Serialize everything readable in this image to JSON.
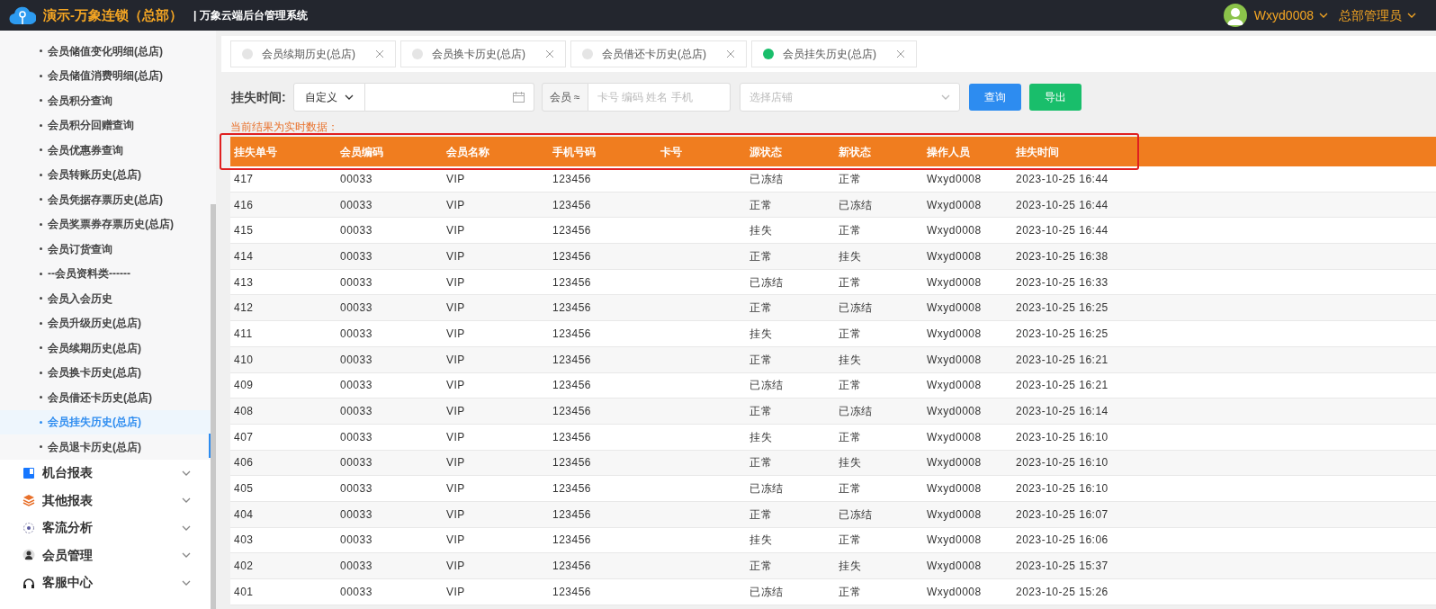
{
  "header": {
    "brand": "演示-万象连锁（总部）",
    "system": "| 万象云端后台管理系统",
    "user": "Wxyd0008",
    "role": "总部管理员"
  },
  "sidebar": {
    "items": [
      {
        "label": "会员储值变化明细(总店)",
        "selected": false
      },
      {
        "label": "会员储值消费明细(总店)",
        "selected": false
      },
      {
        "label": "会员积分查询",
        "selected": false
      },
      {
        "label": "会员积分回赠查询",
        "selected": false
      },
      {
        "label": "会员优惠券查询",
        "selected": false
      },
      {
        "label": "会员转账历史(总店)",
        "selected": false
      },
      {
        "label": "会员凭据存票历史(总店)",
        "selected": false
      },
      {
        "label": "会员奖票券存票历史(总店)",
        "selected": false
      },
      {
        "label": "会员订货查询",
        "selected": false
      },
      {
        "label": "--会员资料类------",
        "selected": false
      },
      {
        "label": "会员入会历史",
        "selected": false
      },
      {
        "label": "会员升级历史(总店)",
        "selected": false
      },
      {
        "label": "会员续期历史(总店)",
        "selected": false
      },
      {
        "label": "会员换卡历史(总店)",
        "selected": false
      },
      {
        "label": "会员借还卡历史(总店)",
        "selected": false
      },
      {
        "label": "会员挂失历史(总店)",
        "selected": true
      },
      {
        "label": "会员退卡历史(总店)",
        "selected": false
      }
    ],
    "groups": [
      {
        "label": "机台报表",
        "expanded": false
      },
      {
        "label": "其他报表",
        "expanded": false
      },
      {
        "label": "客流分析",
        "expanded": false
      },
      {
        "label": "会员管理",
        "expanded": false
      },
      {
        "label": "客服中心",
        "expanded": false
      }
    ]
  },
  "tabs": [
    {
      "label": "会员续期历史(总店)",
      "selected": false
    },
    {
      "label": "会员换卡历史(总店)",
      "selected": false
    },
    {
      "label": "会员借还卡历史(总店)",
      "selected": false
    },
    {
      "label": "会员挂失历史(总店)",
      "selected": true
    }
  ],
  "filters": {
    "time_label": "挂失时间:",
    "range": "自定义",
    "member_prefix": "会员 ≈",
    "member_placeholder": "卡号 编码 姓名 手机",
    "store_placeholder": "选择店铺",
    "query": "查询",
    "export": "导出"
  },
  "notice": "当前结果为实时数据：",
  "table": {
    "columns": [
      "挂失单号",
      "会员编码",
      "会员名称",
      "手机号码",
      "卡号",
      "源状态",
      "新状态",
      "操作人员",
      "挂失时间"
    ],
    "rows": [
      [
        "417",
        "00033",
        "VIP",
        "123456",
        "",
        "已冻结",
        "正常",
        "Wxyd0008",
        "2023-10-25 16:44"
      ],
      [
        "416",
        "00033",
        "VIP",
        "123456",
        "",
        "正常",
        "已冻结",
        "Wxyd0008",
        "2023-10-25 16:44"
      ],
      [
        "415",
        "00033",
        "VIP",
        "123456",
        "",
        "挂失",
        "正常",
        "Wxyd0008",
        "2023-10-25 16:44"
      ],
      [
        "414",
        "00033",
        "VIP",
        "123456",
        "",
        "正常",
        "挂失",
        "Wxyd0008",
        "2023-10-25 16:38"
      ],
      [
        "413",
        "00033",
        "VIP",
        "123456",
        "",
        "已冻结",
        "正常",
        "Wxyd0008",
        "2023-10-25 16:33"
      ],
      [
        "412",
        "00033",
        "VIP",
        "123456",
        "",
        "正常",
        "已冻结",
        "Wxyd0008",
        "2023-10-25 16:25"
      ],
      [
        "411",
        "00033",
        "VIP",
        "123456",
        "",
        "挂失",
        "正常",
        "Wxyd0008",
        "2023-10-25 16:25"
      ],
      [
        "410",
        "00033",
        "VIP",
        "123456",
        "",
        "正常",
        "挂失",
        "Wxyd0008",
        "2023-10-25 16:21"
      ],
      [
        "409",
        "00033",
        "VIP",
        "123456",
        "",
        "已冻结",
        "正常",
        "Wxyd0008",
        "2023-10-25 16:21"
      ],
      [
        "408",
        "00033",
        "VIP",
        "123456",
        "",
        "正常",
        "已冻结",
        "Wxyd0008",
        "2023-10-25 16:14"
      ],
      [
        "407",
        "00033",
        "VIP",
        "123456",
        "",
        "挂失",
        "正常",
        "Wxyd0008",
        "2023-10-25 16:10"
      ],
      [
        "406",
        "00033",
        "VIP",
        "123456",
        "",
        "正常",
        "挂失",
        "Wxyd0008",
        "2023-10-25 16:10"
      ],
      [
        "405",
        "00033",
        "VIP",
        "123456",
        "",
        "已冻结",
        "正常",
        "Wxyd0008",
        "2023-10-25 16:10"
      ],
      [
        "404",
        "00033",
        "VIP",
        "123456",
        "",
        "正常",
        "已冻结",
        "Wxyd0008",
        "2023-10-25 16:07"
      ],
      [
        "403",
        "00033",
        "VIP",
        "123456",
        "",
        "挂失",
        "正常",
        "Wxyd0008",
        "2023-10-25 16:06"
      ],
      [
        "402",
        "00033",
        "VIP",
        "123456",
        "",
        "正常",
        "挂失",
        "Wxyd0008",
        "2023-10-25 15:37"
      ],
      [
        "401",
        "00033",
        "VIP",
        "123456",
        "",
        "已冻结",
        "正常",
        "Wxyd0008",
        "2023-10-25 15:26"
      ]
    ]
  }
}
